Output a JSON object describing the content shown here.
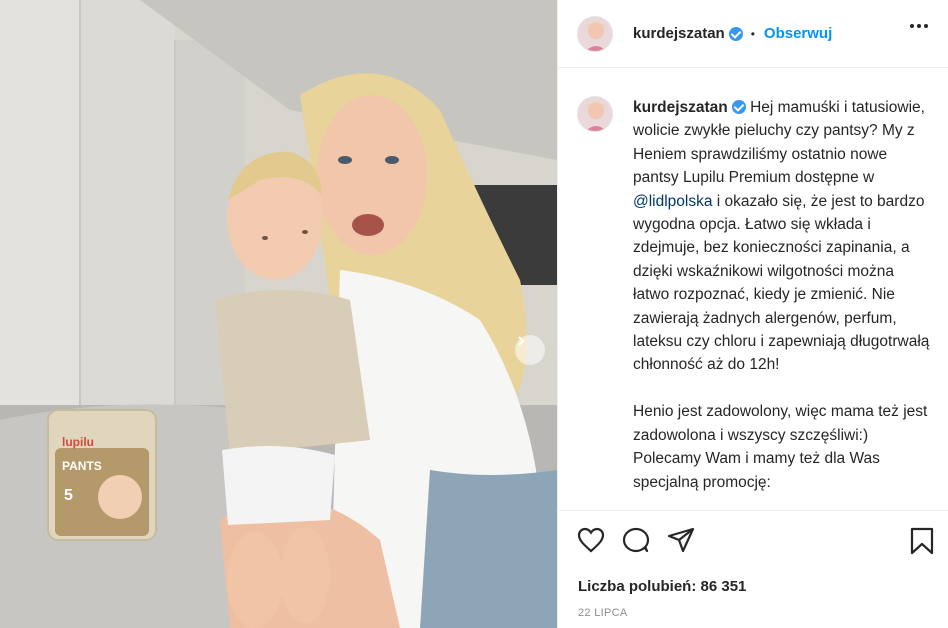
{
  "post": {
    "username": "kurdejszatan",
    "dot": "•",
    "follow_label": "Obserwuj",
    "more_icon": "more-horizontal-icon",
    "caption_part1": "Hej mamuśki i tatusiowie, wolicie zwykłe pieluchy czy pantsy? My z Heniem sprawdziliśmy ostatnio nowe pantsy Lupilu Premium dostępne w ",
    "mention": "@lidlpolska",
    "caption_part2": " i okazało się, że jest to bardzo wygodna opcja. Łatwo się wkłada i zdejmuje, bez konieczności zapinania, a dzięki wskaźnikowi wilgotności można łatwo rozpoznać, kiedy je zmienić. Nie zawierają żadnych alergenów, perfum, lateksu czy chloru i zapewniają długotrwałą chłonność aż do 12h!\n\nHenio jest zadowolony, więc mama też jest zadowolona i wszyscy szczęśliwi:) Polecamy Wam i mamy też dla Was specjalną promocję:",
    "likes_label": "Liczba polubień: 86 351",
    "date": "22 LIPCA"
  },
  "photo": {
    "package_brand": "lupilu",
    "package_type": "PANTS",
    "package_size": "5",
    "alt": ""
  },
  "colors": {
    "follow_blue": "#0095f6",
    "verified_blue": "#3897f0",
    "mention_blue": "#00376b",
    "border": "#efefef"
  }
}
